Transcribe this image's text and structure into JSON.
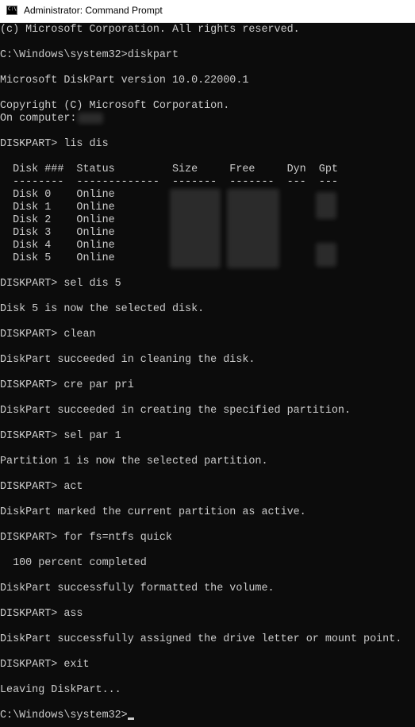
{
  "window": {
    "title": "Administrator: Command Prompt",
    "icon": "cmd-app-icon",
    "icon_glyph": "C:\\"
  },
  "console": {
    "lines": [
      "(c) Microsoft Corporation. All rights reserved.",
      "",
      "C:\\Windows\\system32>diskpart",
      "",
      "Microsoft DiskPart version 10.0.22000.1",
      "",
      "Copyright (C) Microsoft Corporation.",
      "On computer: ",
      "",
      "DISKPART> lis dis",
      "",
      "  Disk ###  Status         Size     Free     Dyn  Gpt",
      "  --------  -------------  -------  -------  ---  ---",
      "  Disk 0    Online",
      "  Disk 1    Online",
      "  Disk 2    Online",
      "  Disk 3    Online",
      "  Disk 4    Online",
      "  Disk 5    Online",
      "",
      "DISKPART> sel dis 5",
      "",
      "Disk 5 is now the selected disk.",
      "",
      "DISKPART> clean",
      "",
      "DiskPart succeeded in cleaning the disk.",
      "",
      "DISKPART> cre par pri",
      "",
      "DiskPart succeeded in creating the specified partition.",
      "",
      "DISKPART> sel par 1",
      "",
      "Partition 1 is now the selected partition.",
      "",
      "DISKPART> act",
      "",
      "DiskPart marked the current partition as active.",
      "",
      "DISKPART> for fs=ntfs quick",
      "",
      "  100 percent completed",
      "",
      "DiskPart successfully formatted the volume.",
      "",
      "DISKPART> ass",
      "",
      "DiskPart successfully assigned the drive letter or mount point.",
      "",
      "DISKPART> exit",
      "",
      "Leaving DiskPart...",
      "",
      "C:\\Windows\\system32>"
    ]
  },
  "colors": {
    "background": "#0c0c0c",
    "foreground": "#cccccc",
    "titlebar": "#ffffff"
  }
}
